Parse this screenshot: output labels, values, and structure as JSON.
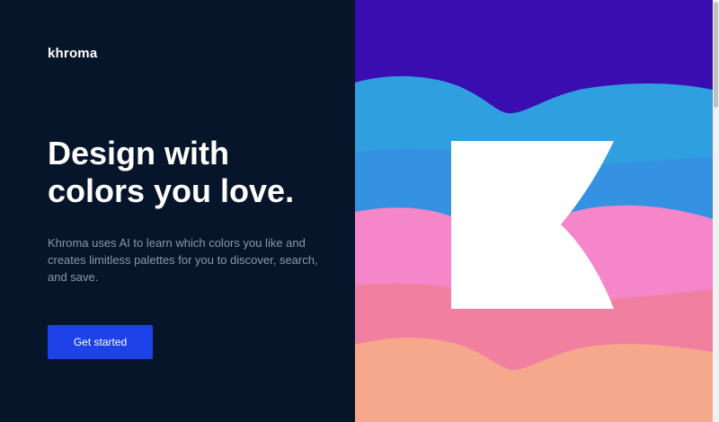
{
  "brand": {
    "logo_text": "khroma"
  },
  "hero": {
    "headline_line1": "Design with",
    "headline_line2": "colors you love.",
    "description": "Khroma uses AI to learn which colors you like and creates limitless palettes for you to discover, search, and save.",
    "cta_label": "Get started"
  },
  "colors": {
    "background": "#07152a",
    "accent": "#1d43e8",
    "wave_purple": "#3a0db0",
    "wave_blue": "#2f9fe0",
    "wave_pink": "#f486c9",
    "wave_rose": "#f07e92",
    "wave_peach": "#f6a88c"
  },
  "icons": {
    "brand_mark": "khroma-k-icon"
  }
}
